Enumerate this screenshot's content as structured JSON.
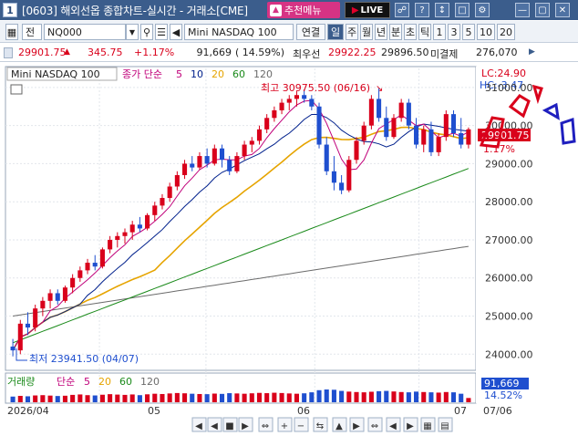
{
  "titlebar": {
    "window_number": "1",
    "title": "[0603] 해외선옵 종합차트-실시간 - 거래소[CME]",
    "recommend_label": "추천메뉴",
    "live_label": "LIVE"
  },
  "toolbar": {
    "prefix_label": "전",
    "symbol_code": "NQ000",
    "symbol_name": "Mini NASDAQ 100",
    "link_label": "연결",
    "periods": [
      "일",
      "주",
      "월",
      "년",
      "분",
      "초",
      "틱",
      "1",
      "3",
      "5",
      "10",
      "20"
    ],
    "selected_period": "일"
  },
  "quote": {
    "price": "29901.75",
    "change": "345.75",
    "change_pct": "+1.17%",
    "volume": "91,669",
    "volume_ratio": "( 14.59%)",
    "best_bid_label": "최우선",
    "best_ask": "29922.25",
    "best_bid": "29896.50",
    "open_interest_label": "미결제",
    "open_interest": "276,070"
  },
  "legend": {
    "name": "Mini NASDAQ 100",
    "ma_label": "종가 단순",
    "ma_periods": [
      "5",
      "10",
      "20",
      "60",
      "120"
    ]
  },
  "right_axis": {
    "lc_label": "LC:24.90",
    "hc_label": "HC:-3.47",
    "current_price": "29901.75",
    "current_pct": "1.17%",
    "ticks": [
      "31000.00",
      "30000.00",
      "29000.00",
      "28000.00",
      "27000.00",
      "26000.00",
      "25000.00",
      "24000.00"
    ]
  },
  "annotations": {
    "high": "최고 30975.50 (06/16)",
    "low": "최저 23941.50 (04/07)"
  },
  "volume_panel": {
    "legend_label": "거래량",
    "ma_label": "단순",
    "ma_periods": [
      "5",
      "20",
      "60",
      "120"
    ],
    "right_value": "91,669",
    "right_pct": "14.52%"
  },
  "x_axis": {
    "labels": [
      "2026/04",
      "05",
      "06",
      "07",
      "07/06"
    ]
  },
  "colors": {
    "up": "#d9001b",
    "down": "#1f4fcf",
    "ma5": "#c0007a",
    "ma10": "#00208c",
    "ma20": "#e6a400",
    "ma60": "#1a8a1a",
    "ma120": "#6b6b6b"
  },
  "chart_data": {
    "type": "candlestick",
    "ylim": [
      23600,
      31500
    ],
    "ohlc": [
      [
        24200,
        24400,
        23941.5,
        24100
      ],
      [
        24100,
        24900,
        24000,
        24800
      ],
      [
        24800,
        25100,
        24500,
        24700
      ],
      [
        24700,
        25300,
        24600,
        25200
      ],
      [
        25200,
        25500,
        25000,
        25400
      ],
      [
        25400,
        25700,
        25200,
        25600
      ],
      [
        25600,
        25700,
        25300,
        25400
      ],
      [
        25400,
        25800,
        25350,
        25750
      ],
      [
        25750,
        26100,
        25600,
        26000
      ],
      [
        26000,
        26300,
        25900,
        26200
      ],
      [
        26200,
        26500,
        26100,
        26400
      ],
      [
        26400,
        26600,
        26200,
        26300
      ],
      [
        26300,
        26800,
        26250,
        26750
      ],
      [
        26750,
        27100,
        26650,
        27000
      ],
      [
        27000,
        27200,
        26800,
        27100
      ],
      [
        27100,
        27300,
        26900,
        27200
      ],
      [
        27200,
        27500,
        27000,
        27400
      ],
      [
        27400,
        27600,
        27200,
        27300
      ],
      [
        27300,
        27700,
        27250,
        27650
      ],
      [
        27650,
        28000,
        27500,
        27900
      ],
      [
        27900,
        28200,
        27800,
        28100
      ],
      [
        28100,
        28500,
        28000,
        28400
      ],
      [
        28400,
        28800,
        28300,
        28700
      ],
      [
        28700,
        29100,
        28600,
        29000
      ],
      [
        29000,
        29200,
        28800,
        28900
      ],
      [
        28900,
        29300,
        28850,
        29200
      ],
      [
        29200,
        29400,
        28900,
        29000
      ],
      [
        29000,
        29500,
        28950,
        29400
      ],
      [
        29400,
        29500,
        28900,
        29100
      ],
      [
        29100,
        29200,
        28700,
        28800
      ],
      [
        28800,
        29300,
        28750,
        29200
      ],
      [
        29200,
        29600,
        29100,
        29500
      ],
      [
        29500,
        29700,
        29300,
        29600
      ],
      [
        29600,
        30000,
        29500,
        29900
      ],
      [
        29900,
        30300,
        29800,
        30200
      ],
      [
        30200,
        30500,
        30100,
        30400
      ],
      [
        30400,
        30700,
        30300,
        30600
      ],
      [
        30600,
        30800,
        30400,
        30700
      ],
      [
        30700,
        30900,
        30500,
        30800
      ],
      [
        30800,
        30950,
        30600,
        30700
      ],
      [
        30700,
        30800,
        30400,
        30500
      ],
      [
        30500,
        30600,
        29400,
        29500
      ],
      [
        29500,
        29700,
        28700,
        28800
      ],
      [
        28800,
        29200,
        28300,
        28500
      ],
      [
        28500,
        28700,
        28200,
        28300
      ],
      [
        28300,
        29200,
        28250,
        29100
      ],
      [
        29100,
        29700,
        29000,
        29600
      ],
      [
        29600,
        30100,
        29500,
        30000
      ],
      [
        30000,
        30800,
        29900,
        30700
      ],
      [
        30700,
        30975.5,
        30100,
        30200
      ],
      [
        30200,
        30500,
        29600,
        29700
      ],
      [
        29700,
        30300,
        29650,
        30200
      ],
      [
        30200,
        30700,
        30100,
        30600
      ],
      [
        30600,
        30700,
        29900,
        30000
      ],
      [
        30000,
        30200,
        29400,
        29500
      ],
      [
        29500,
        30000,
        29300,
        29900
      ],
      [
        29900,
        30100,
        29200,
        29300
      ],
      [
        29300,
        29800,
        29200,
        29700
      ],
      [
        29700,
        30400,
        29600,
        30300
      ],
      [
        30300,
        30400,
        29700,
        29800
      ],
      [
        29800,
        30200,
        29400,
        29500
      ],
      [
        29500,
        29950,
        29400,
        29901.75
      ]
    ],
    "volume": [
      40,
      45,
      42,
      48,
      50,
      47,
      44,
      46,
      52,
      55,
      50,
      48,
      53,
      57,
      54,
      52,
      55,
      50,
      56,
      60,
      58,
      62,
      65,
      63,
      60,
      58,
      57,
      61,
      59,
      64,
      62,
      60,
      63,
      66,
      64,
      67,
      65,
      62,
      60,
      63,
      70,
      85,
      90,
      88,
      80,
      75,
      72,
      70,
      74,
      78,
      80,
      76,
      72,
      70,
      75,
      72,
      70,
      68,
      72,
      70,
      60,
      30
    ]
  }
}
